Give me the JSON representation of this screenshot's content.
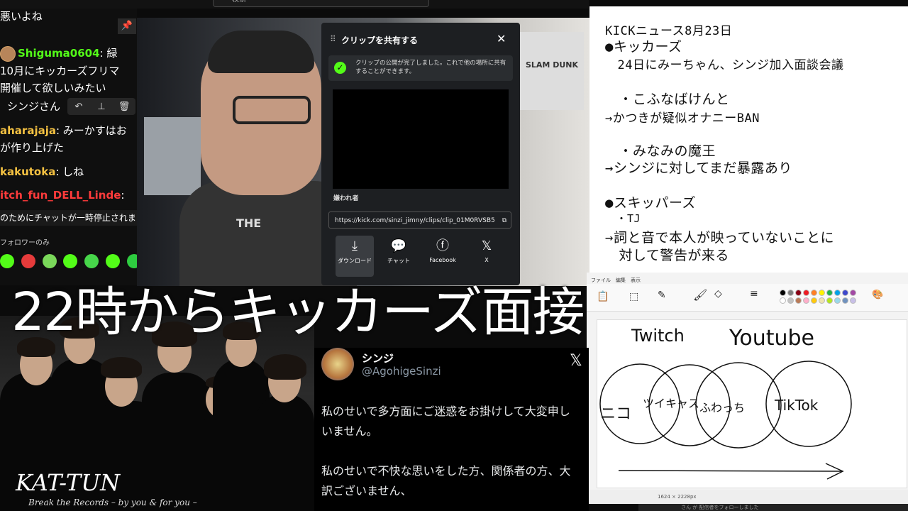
{
  "search": {
    "placeholder": "検索"
  },
  "chat": {
    "lines": [
      {
        "prefix": "",
        "text": "悪いよね"
      },
      {
        "user": "Shiguma0604",
        "text": ": 緑"
      },
      {
        "prefix": "",
        "text": "10月にキッカーズフリマ"
      },
      {
        "prefix": "",
        "text": "開催して欲しいみたい"
      },
      {
        "prefix": "",
        "text": "シンジさん"
      },
      {
        "user": "aharajaja",
        "text": ": みーかすはお"
      },
      {
        "prefix": "",
        "text": "が作り上げた"
      },
      {
        "user": "kakutoka",
        "text": ": しね"
      },
      {
        "user": "itch_fun_DELL_Linde",
        "text": ":"
      },
      {
        "prefix": "",
        "text": "のためにチャットが一時停止されま"
      },
      {
        "prefix": "",
        "text": "フォロワーのみ"
      }
    ],
    "icons": {
      "pin": "pin-icon",
      "reply": "reply-icon",
      "delete": "trash-icon"
    }
  },
  "clip_dialog": {
    "title": "クリップを共有する",
    "success_message": "クリップの公開が完了しました。これで他の場所に共有することができます。",
    "clip_title": "嫌われ者",
    "url": "https://kick.com/sinzi_jimny/clips/clip_01M0RVSB5",
    "share": [
      {
        "label": "ダウンロード",
        "icon": "download-icon"
      },
      {
        "label": "チャット",
        "icon": "chat-icon"
      },
      {
        "label": "Facebook",
        "icon": "facebook-icon"
      },
      {
        "label": "X",
        "icon": "x-icon"
      }
    ]
  },
  "webcam": {
    "poster_text": "SLAM DUNK",
    "shirt_text": "THE"
  },
  "news": {
    "lines": [
      "KICKニュース8月23日",
      "●キッカーズ",
      "　24日にみーちゃん、シンジ加入面談会議",
      "　・こふなばけんと",
      "→かつきが疑似オナニーBAN",
      "　・みなみの魔王",
      "→シンジに対してまだ暴露あり",
      "●スキッパーズ",
      "　・TJ",
      "→詞と音で本人が映っていないことに",
      "　対して警告が来る"
    ]
  },
  "overlay": {
    "text": "22時からキッカーズ面接"
  },
  "tweet": {
    "name": "シンジ",
    "handle": "@AgohigeSinzi",
    "body": "私のせいで多方面にご迷惑をお掛けして大変申し\nいません。\n\n私のせいで不快な思いをした方、関係者の方、大\n訳ございません、"
  },
  "kat": {
    "band": "KAT-TUN",
    "subtitle": "Break the Records – by you & for you –"
  },
  "paint": {
    "menu": "ファイル　編集　表示",
    "handwriting": [
      "Twitch",
      "Youtube",
      "ニコ",
      "ツイキャス",
      "ふわっち",
      "TikTok"
    ],
    "status": "1624 × 2228px",
    "palette": [
      "#000000",
      "#7f7f7f",
      "#880015",
      "#ed1c24",
      "#ff7f27",
      "#fff200",
      "#22b14c",
      "#00a2e8",
      "#3f48cc",
      "#a349a4",
      "#ffffff",
      "#c3c3c3",
      "#b97a57",
      "#ffaec9",
      "#ffc90e",
      "#efe4b0",
      "#b5e61d",
      "#99d9ea",
      "#7092be",
      "#c8bfe7"
    ]
  },
  "bottom_strip": {
    "text": "さん が 配信者をフォローしました"
  }
}
